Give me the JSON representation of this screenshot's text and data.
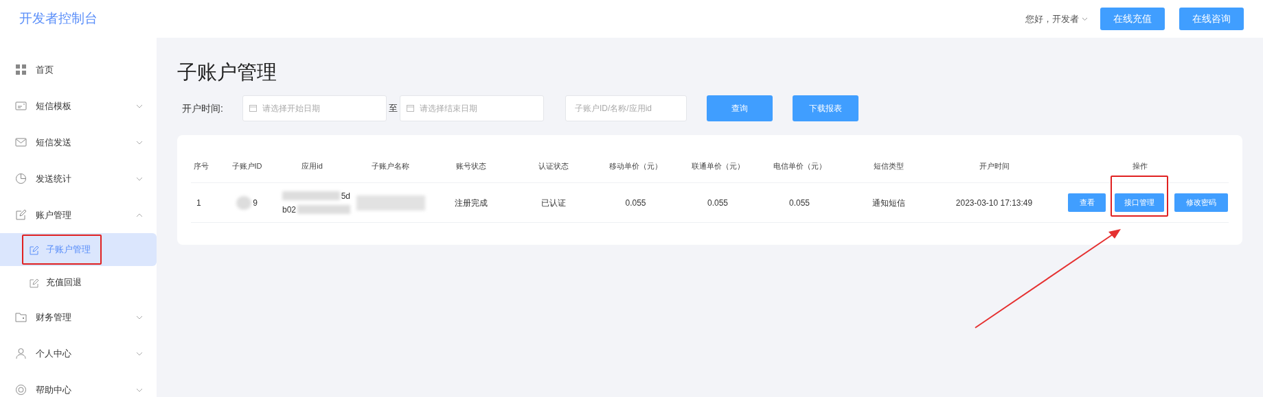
{
  "app": {
    "title": "开发者控制台"
  },
  "header": {
    "greeting": "您好，开发者",
    "buttons": [
      "在线充值",
      "在线咨询"
    ]
  },
  "sidebar": {
    "items": [
      {
        "label": "首页",
        "kind": "link"
      },
      {
        "label": "短信模板",
        "kind": "group",
        "expanded": false
      },
      {
        "label": "短信发送",
        "kind": "group",
        "expanded": false
      },
      {
        "label": "发送统计",
        "kind": "group",
        "expanded": false
      },
      {
        "label": "账户管理",
        "kind": "group",
        "expanded": true,
        "children": [
          {
            "label": "子账户管理",
            "selected": true
          },
          {
            "label": "充值回退",
            "selected": false
          }
        ]
      },
      {
        "label": "财务管理",
        "kind": "group",
        "expanded": false
      },
      {
        "label": "个人中心",
        "kind": "group",
        "expanded": false
      },
      {
        "label": "帮助中心",
        "kind": "group",
        "expanded": false
      }
    ]
  },
  "page": {
    "title": "子账户管理"
  },
  "filters": {
    "date_label": "开户时间:",
    "start_placeholder": "请选择开始日期",
    "separator": "至",
    "end_placeholder": "请选择结束日期",
    "search_placeholder": "子账户ID/名称/应用id",
    "buttons": [
      "查询",
      "下载报表"
    ]
  },
  "table": {
    "columns": [
      "序号",
      "子账户ID",
      "应用id",
      "子账户名称",
      "账号状态",
      "认证状态",
      "移动单价（元）",
      "联通单价（元）",
      "电信单价（元）",
      "短信类型",
      "开户时间",
      "操作"
    ],
    "rows": [
      {
        "index": "1",
        "sub_account_id": "9",
        "app_id": [
          "5d",
          "b02"
        ],
        "status": "注册完成",
        "verification": "已认证",
        "mobile_price": "0.055",
        "unicom_price": "0.055",
        "telecom_price": "0.055",
        "sms_type": "通知短信",
        "opened_at": "2023-03-10 17:13:49",
        "actions": [
          "查看",
          "接口管理",
          "修改密码"
        ]
      }
    ]
  }
}
